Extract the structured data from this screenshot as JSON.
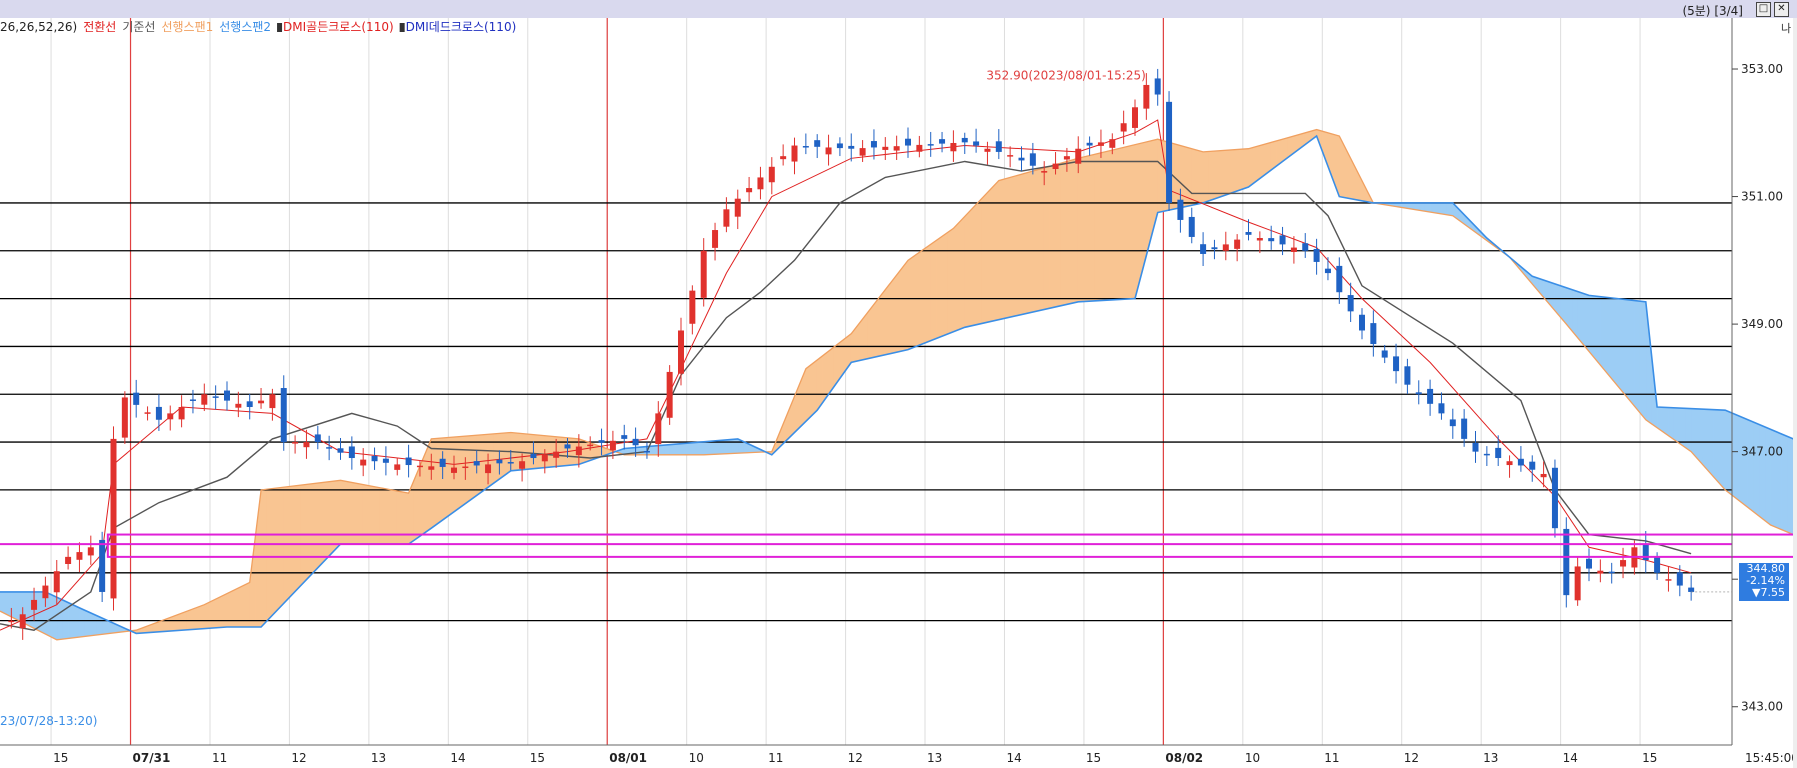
{
  "window": {
    "timeframe": "(5분)",
    "page": "[3/4]",
    "btn_restore": "□",
    "btn_close": "✕",
    "side_label": "나"
  },
  "legend": [
    {
      "text": "26,26,52,26)",
      "color": "#222222"
    },
    {
      "text": "전환선",
      "color": "#e02020"
    },
    {
      "text": "기준선",
      "color": "#555555"
    },
    {
      "text": "선행스팬1",
      "color": "#f0a060"
    },
    {
      "text": "선행스팬2",
      "color": "#3a8ee6"
    },
    {
      "text": "DMI골든크로스(110)",
      "color": "#e02020"
    },
    {
      "text": "DMI데드크로스(110)",
      "color": "#2030c0"
    }
  ],
  "annotations": {
    "high": "352.90(2023/08/01-15:25)",
    "low": "23/07/28-13:20)"
  },
  "price_badge": {
    "price": "344.80",
    "change_pct": "-2.14%",
    "change": "▼7.55"
  },
  "colors": {
    "up": "#e0322d",
    "down": "#1f62c4",
    "tenkan": "#e02020",
    "kijun": "#555555",
    "span1": "#f0a060",
    "span2": "#3a8ee6",
    "cloud_up": "#f9c592",
    "cloud_down": "#9ccdf5",
    "hline": "#000000",
    "magenta": "#e020d8",
    "session": "#e04040",
    "badge": "#2f7ce0"
  },
  "chart_data": {
    "type": "candlestick",
    "title": "",
    "y_axis": {
      "range": [
        342.4,
        353.8
      ],
      "ticks": [
        {
          "value": 353,
          "label": "353.00"
        },
        {
          "value": 351,
          "label": "351.00"
        },
        {
          "value": 349,
          "label": "349.00"
        },
        {
          "value": 347,
          "label": "347.00"
        },
        {
          "value": 345,
          "label": "345.00"
        },
        {
          "value": 343,
          "label": "343.00"
        }
      ]
    },
    "x_axis": {
      "labels": [
        "15",
        "07/31",
        "11",
        "12",
        "13",
        "14",
        "15",
        "08/01",
        "10",
        "11",
        "12",
        "13",
        "14",
        "15",
        "08/02",
        "10",
        "11",
        "12",
        "13",
        "14",
        "15",
        "15:45:00"
      ]
    },
    "session_starts": [
      "07/31",
      "08/01",
      "08/02"
    ],
    "horizontal_levels": [
      350.9,
      350.15,
      349.4,
      348.65,
      347.9,
      347.15,
      346.4,
      345.1,
      344.35
    ],
    "magenta_box": {
      "top": 345.7,
      "bottom": 345.35
    },
    "magenta_line": 345.55,
    "last_price": 344.8,
    "high": 352.9,
    "price_path": [
      [
        0,
        344.25
      ],
      [
        2,
        344.45
      ],
      [
        4,
        344.9
      ],
      [
        6,
        345.35
      ],
      [
        8,
        345.5
      ],
      [
        9,
        344.8
      ],
      [
        10,
        347.2
      ],
      [
        11,
        347.85
      ],
      [
        14,
        347.5
      ],
      [
        18,
        347.9
      ],
      [
        22,
        347.7
      ],
      [
        24,
        347.9
      ],
      [
        25,
        347.15
      ],
      [
        28,
        347.15
      ],
      [
        31,
        346.9
      ],
      [
        35,
        346.8
      ],
      [
        40,
        346.75
      ],
      [
        46,
        346.85
      ],
      [
        50,
        347.05
      ],
      [
        55,
        347.2
      ],
      [
        57,
        347.0
      ],
      [
        58,
        347.6
      ],
      [
        60,
        348.9
      ],
      [
        62,
        350.15
      ],
      [
        64,
        350.8
      ],
      [
        67,
        351.3
      ],
      [
        70,
        351.8
      ],
      [
        75,
        351.75
      ],
      [
        80,
        351.8
      ],
      [
        85,
        351.85
      ],
      [
        89,
        351.65
      ],
      [
        92,
        351.4
      ],
      [
        95,
        351.75
      ],
      [
        98,
        351.9
      ],
      [
        100,
        352.4
      ],
      [
        101,
        352.75
      ],
      [
        102,
        352.6
      ],
      [
        103,
        350.9
      ],
      [
        106,
        350.1
      ],
      [
        110,
        350.4
      ],
      [
        115,
        350.15
      ],
      [
        117,
        349.8
      ],
      [
        120,
        348.9
      ],
      [
        124,
        348.05
      ],
      [
        127,
        347.6
      ],
      [
        130,
        347.0
      ],
      [
        133,
        346.85
      ],
      [
        136,
        346.65
      ],
      [
        137,
        345.8
      ],
      [
        138,
        344.75
      ],
      [
        139,
        345.2
      ],
      [
        142,
        345.1
      ],
      [
        144,
        345.5
      ],
      [
        146,
        345.1
      ],
      [
        148,
        344.9
      ],
      [
        149,
        344.8
      ]
    ],
    "tenkan_path": [
      [
        0,
        344.2
      ],
      [
        5,
        344.6
      ],
      [
        9,
        345.4
      ],
      [
        10,
        346.8
      ],
      [
        16,
        347.7
      ],
      [
        24,
        347.6
      ],
      [
        30,
        347.0
      ],
      [
        40,
        346.8
      ],
      [
        50,
        347.0
      ],
      [
        57,
        347.2
      ],
      [
        60,
        348.3
      ],
      [
        64,
        349.8
      ],
      [
        68,
        351.0
      ],
      [
        75,
        351.6
      ],
      [
        85,
        351.8
      ],
      [
        95,
        351.7
      ],
      [
        100,
        352.0
      ],
      [
        102,
        352.2
      ],
      [
        103,
        351.1
      ],
      [
        110,
        350.6
      ],
      [
        116,
        350.2
      ],
      [
        120,
        349.4
      ],
      [
        126,
        348.4
      ],
      [
        132,
        347.2
      ],
      [
        137,
        346.3
      ],
      [
        140,
        345.5
      ],
      [
        145,
        345.3
      ],
      [
        149,
        345.1
      ]
    ],
    "kijun_path": [
      [
        0,
        344.3
      ],
      [
        3,
        344.2
      ],
      [
        8,
        344.8
      ],
      [
        10,
        345.8
      ],
      [
        14,
        346.2
      ],
      [
        20,
        346.6
      ],
      [
        24,
        347.2
      ],
      [
        31,
        347.6
      ],
      [
        35,
        347.4
      ],
      [
        38,
        347.05
      ],
      [
        45,
        347.0
      ],
      [
        52,
        346.9
      ],
      [
        57,
        347.0
      ],
      [
        60,
        348.2
      ],
      [
        64,
        349.1
      ],
      [
        67,
        349.5
      ],
      [
        70,
        350.0
      ],
      [
        74,
        350.9
      ],
      [
        78,
        351.3
      ],
      [
        85,
        351.55
      ],
      [
        90,
        351.4
      ],
      [
        95,
        351.55
      ],
      [
        102,
        351.55
      ],
      [
        105,
        351.05
      ],
      [
        115,
        351.05
      ],
      [
        117,
        350.7
      ],
      [
        120,
        349.6
      ],
      [
        128,
        348.7
      ],
      [
        134,
        347.8
      ],
      [
        137,
        346.4
      ],
      [
        140,
        345.7
      ],
      [
        145,
        345.6
      ],
      [
        149,
        345.4
      ]
    ],
    "span1_path": [
      [
        0,
        344.5
      ],
      [
        5,
        344.05
      ],
      [
        12,
        344.2
      ],
      [
        18,
        344.6
      ],
      [
        22,
        344.95
      ],
      [
        23,
        346.4
      ],
      [
        30,
        346.55
      ],
      [
        36,
        346.35
      ],
      [
        38,
        347.2
      ],
      [
        45,
        347.3
      ],
      [
        51,
        347.2
      ],
      [
        55,
        346.95
      ],
      [
        62,
        346.95
      ],
      [
        68,
        347.0
      ],
      [
        71,
        348.3
      ],
      [
        75,
        348.85
      ],
      [
        80,
        350.0
      ],
      [
        84,
        350.5
      ],
      [
        88,
        351.25
      ],
      [
        95,
        351.6
      ],
      [
        102,
        351.9
      ],
      [
        106,
        351.7
      ],
      [
        110,
        351.75
      ],
      [
        113,
        351.9
      ],
      [
        116,
        352.05
      ],
      [
        118,
        351.95
      ],
      [
        121,
        350.9
      ],
      [
        128,
        350.7
      ],
      [
        133,
        350.05
      ],
      [
        138,
        349.0
      ],
      [
        145,
        347.5
      ],
      [
        149,
        347.0
      ],
      [
        152,
        346.4
      ],
      [
        156,
        345.85
      ],
      [
        160,
        345.55
      ],
      [
        163,
        345.25
      ]
    ],
    "span2_path": [
      [
        0,
        344.8
      ],
      [
        4,
        344.8
      ],
      [
        7,
        344.55
      ],
      [
        12,
        344.15
      ],
      [
        20,
        344.25
      ],
      [
        23,
        344.25
      ],
      [
        30,
        345.55
      ],
      [
        36,
        345.55
      ],
      [
        38,
        345.8
      ],
      [
        45,
        346.7
      ],
      [
        51,
        346.8
      ],
      [
        55,
        347.05
      ],
      [
        65,
        347.2
      ],
      [
        68,
        346.95
      ],
      [
        72,
        347.65
      ],
      [
        75,
        348.4
      ],
      [
        80,
        348.6
      ],
      [
        85,
        348.95
      ],
      [
        95,
        349.35
      ],
      [
        100,
        349.4
      ],
      [
        102,
        350.75
      ],
      [
        106,
        350.9
      ],
      [
        110,
        351.15
      ],
      [
        113,
        351.55
      ],
      [
        116,
        351.95
      ],
      [
        118,
        351.0
      ],
      [
        121,
        350.9
      ],
      [
        128,
        350.9
      ],
      [
        131,
        350.35
      ],
      [
        135,
        349.75
      ],
      [
        140,
        349.45
      ],
      [
        145,
        349.35
      ],
      [
        146,
        347.7
      ],
      [
        152,
        347.65
      ],
      [
        158,
        347.2
      ],
      [
        160,
        346.7
      ],
      [
        163,
        346.45
      ]
    ]
  }
}
